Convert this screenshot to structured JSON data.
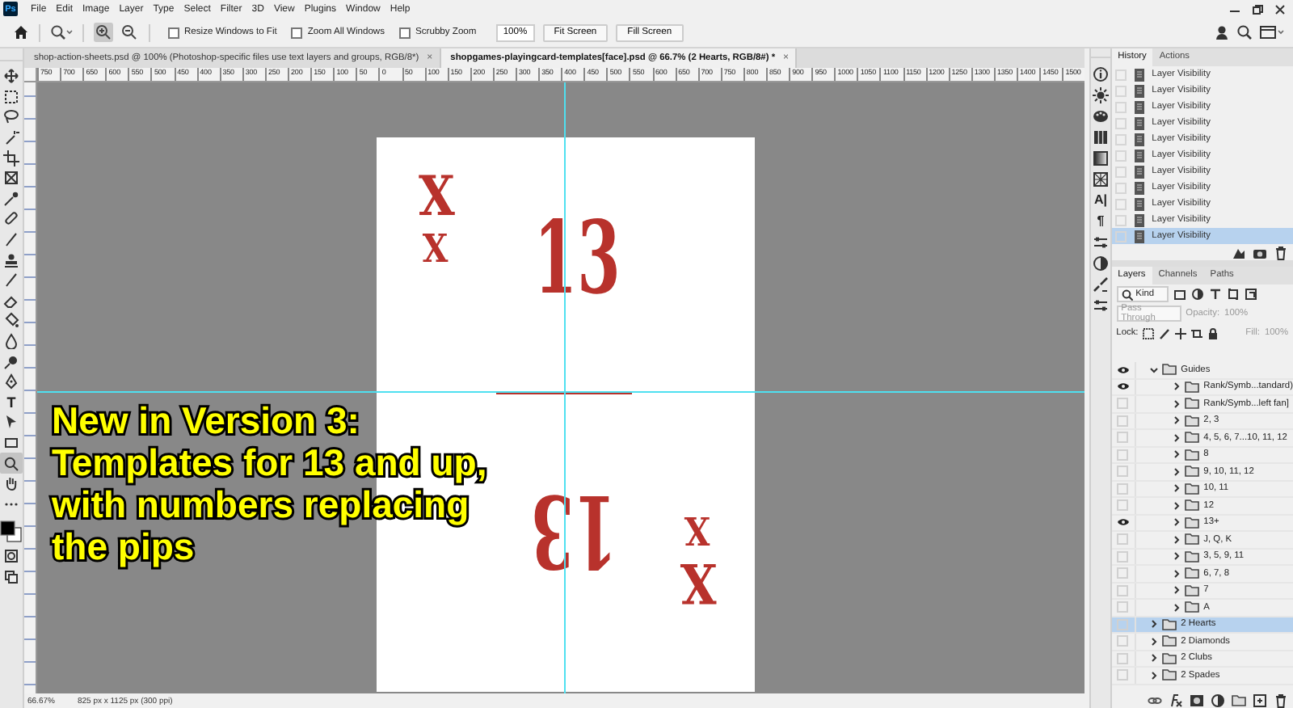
{
  "app_logo": "Ps",
  "menu": [
    "File",
    "Edit",
    "Image",
    "Layer",
    "Type",
    "Select",
    "Filter",
    "3D",
    "View",
    "Plugins",
    "Window",
    "Help"
  ],
  "options": {
    "checkboxes": [
      {
        "label": "Resize Windows to Fit",
        "checked": false
      },
      {
        "label": "Zoom All Windows",
        "checked": false
      },
      {
        "label": "Scrubby Zoom",
        "checked": false
      }
    ],
    "zoom_value": "100%",
    "buttons": [
      "Fit Screen",
      "Fill Screen"
    ]
  },
  "tabs": [
    {
      "label": "shop-action-sheets.psd @ 100% (Photoshop-specific files use text layers and groups, RGB/8*)",
      "close": "×",
      "selected": false
    },
    {
      "label": "shopgames-playingcard-templates[face].psd @ 66.7% (2 Hearts, RGB/8#) *",
      "close": "×",
      "selected": true
    }
  ],
  "ruler_labels": [
    "750",
    "700",
    "650",
    "600",
    "550",
    "500",
    "450",
    "400",
    "350",
    "300",
    "250",
    "200",
    "150",
    "100",
    "50",
    "0",
    "50",
    "100",
    "150",
    "200",
    "250",
    "300",
    "350",
    "400",
    "450",
    "500",
    "550",
    "600",
    "650",
    "700",
    "750",
    "800",
    "850",
    "900",
    "950",
    "1000",
    "1050",
    "1100",
    "1150",
    "1200",
    "1250",
    "1300",
    "1350",
    "1400",
    "1450",
    "1500"
  ],
  "tools": [
    {
      "kind": "move",
      "selected": false
    },
    {
      "kind": "marquee",
      "selected": false
    },
    {
      "kind": "lasso",
      "selected": false
    },
    {
      "kind": "wand",
      "selected": false
    },
    {
      "kind": "crop",
      "selected": false
    },
    {
      "kind": "frame",
      "selected": false
    },
    {
      "kind": "eyedropper",
      "selected": false
    },
    {
      "kind": "healing",
      "selected": false
    },
    {
      "kind": "brush",
      "selected": false
    },
    {
      "kind": "stamp",
      "selected": false
    },
    {
      "kind": "brush",
      "selected": false
    },
    {
      "kind": "eraser",
      "selected": false
    },
    {
      "kind": "bucket",
      "selected": false
    },
    {
      "kind": "drop",
      "selected": false
    },
    {
      "kind": "dodge",
      "selected": false
    },
    {
      "kind": "pen",
      "selected": false
    },
    {
      "kind": "type",
      "glyph": "T",
      "selected": false
    },
    {
      "kind": "arrow",
      "selected": false
    },
    {
      "kind": "rectangle",
      "selected": false
    },
    {
      "kind": "zoom",
      "selected": true
    },
    {
      "kind": "hand",
      "selected": false
    },
    {
      "kind": "more",
      "selected": false
    },
    {
      "kind": "swatches",
      "selected": false
    },
    {
      "kind": "mask",
      "selected": false
    },
    {
      "kind": "screen",
      "selected": false
    }
  ],
  "card": {
    "ranks": [
      "13",
      "13"
    ],
    "pips": [
      "X",
      "X",
      "X",
      "X"
    ]
  },
  "overlay_text": [
    "New in Version 3:",
    "Templates for 13 and up,",
    "with numbers replacing",
    "the pips"
  ],
  "status_bar": {
    "zoom": "66.67%",
    "size": "825 px x 1125 px (300 ppi)"
  },
  "history": {
    "tabs": [
      {
        "label": "History",
        "selected": true
      },
      {
        "label": "Actions",
        "selected": false
      }
    ],
    "rows": [
      {
        "label": "Layer Visibility",
        "selected": false
      },
      {
        "label": "Layer Visibility",
        "selected": false
      },
      {
        "label": "Layer Visibility",
        "selected": false
      },
      {
        "label": "Layer Visibility",
        "selected": false
      },
      {
        "label": "Layer Visibility",
        "selected": false
      },
      {
        "label": "Layer Visibility",
        "selected": false
      },
      {
        "label": "Layer Visibility",
        "selected": false
      },
      {
        "label": "Layer Visibility",
        "selected": false
      },
      {
        "label": "Layer Visibility",
        "selected": false
      },
      {
        "label": "Layer Visibility",
        "selected": false
      },
      {
        "label": "Layer Visibility",
        "selected": true
      }
    ]
  },
  "layers_panel": {
    "tabs": [
      {
        "label": "Layers",
        "selected": true
      },
      {
        "label": "Channels",
        "selected": false
      },
      {
        "label": "Paths",
        "selected": false
      }
    ],
    "filter": "Kind",
    "blend_mode": "Pass Through",
    "opacity_label": "Opacity:",
    "opacity": "100%",
    "lock_label": "Lock:",
    "fill_label": "Fill:",
    "fill": "100%",
    "layers": [
      {
        "name": "Guides",
        "visible": true,
        "expanded": true,
        "selected": false,
        "children": [
          {
            "name": "Rank/Symb...tandard)",
            "visible": true,
            "expanded": false,
            "selected": false
          },
          {
            "name": "Rank/Symb...left fan]",
            "visible": false,
            "expanded": false,
            "selected": false
          },
          {
            "name": "2, 3",
            "visible": false,
            "expanded": false,
            "selected": false
          },
          {
            "name": "4, 5, 6, 7...10, 11, 12",
            "visible": false,
            "expanded": false,
            "selected": false
          },
          {
            "name": "8",
            "visible": false,
            "expanded": false,
            "selected": false
          },
          {
            "name": "9, 10, 11, 12",
            "visible": false,
            "expanded": false,
            "selected": false
          },
          {
            "name": "10, 11",
            "visible": false,
            "expanded": false,
            "selected": false
          },
          {
            "name": "12",
            "visible": false,
            "expanded": false,
            "selected": false
          },
          {
            "name": "13+",
            "visible": true,
            "expanded": false,
            "selected": false
          },
          {
            "name": "J, Q, K",
            "visible": false,
            "expanded": false,
            "selected": false
          },
          {
            "name": "3, 5, 9, 11",
            "visible": false,
            "expanded": false,
            "selected": false
          },
          {
            "name": "6, 7, 8",
            "visible": false,
            "expanded": false,
            "selected": false
          },
          {
            "name": "7",
            "visible": false,
            "expanded": false,
            "selected": false
          },
          {
            "name": "A",
            "visible": false,
            "expanded": false,
            "selected": false
          }
        ]
      },
      {
        "name": "2 Hearts",
        "visible": false,
        "expanded": false,
        "selected": true
      },
      {
        "name": "2 Diamonds",
        "visible": false,
        "expanded": false,
        "selected": false
      },
      {
        "name": "2 Clubs",
        "visible": false,
        "expanded": false,
        "selected": false
      },
      {
        "name": "2 Spades",
        "visible": false,
        "expanded": false,
        "selected": false
      }
    ]
  },
  "side_strip": [
    {
      "kind": "info"
    },
    {
      "kind": "sun"
    },
    {
      "kind": "palette"
    },
    {
      "kind": "grid"
    },
    {
      "kind": "gradient"
    },
    {
      "kind": "pattern"
    },
    {
      "kind": "glyph",
      "glyph": "A|"
    },
    {
      "kind": "glyph",
      "glyph": "¶"
    },
    {
      "kind": "sliders"
    },
    {
      "kind": "adjust"
    },
    {
      "kind": "brushes"
    },
    {
      "kind": "sliders"
    }
  ]
}
